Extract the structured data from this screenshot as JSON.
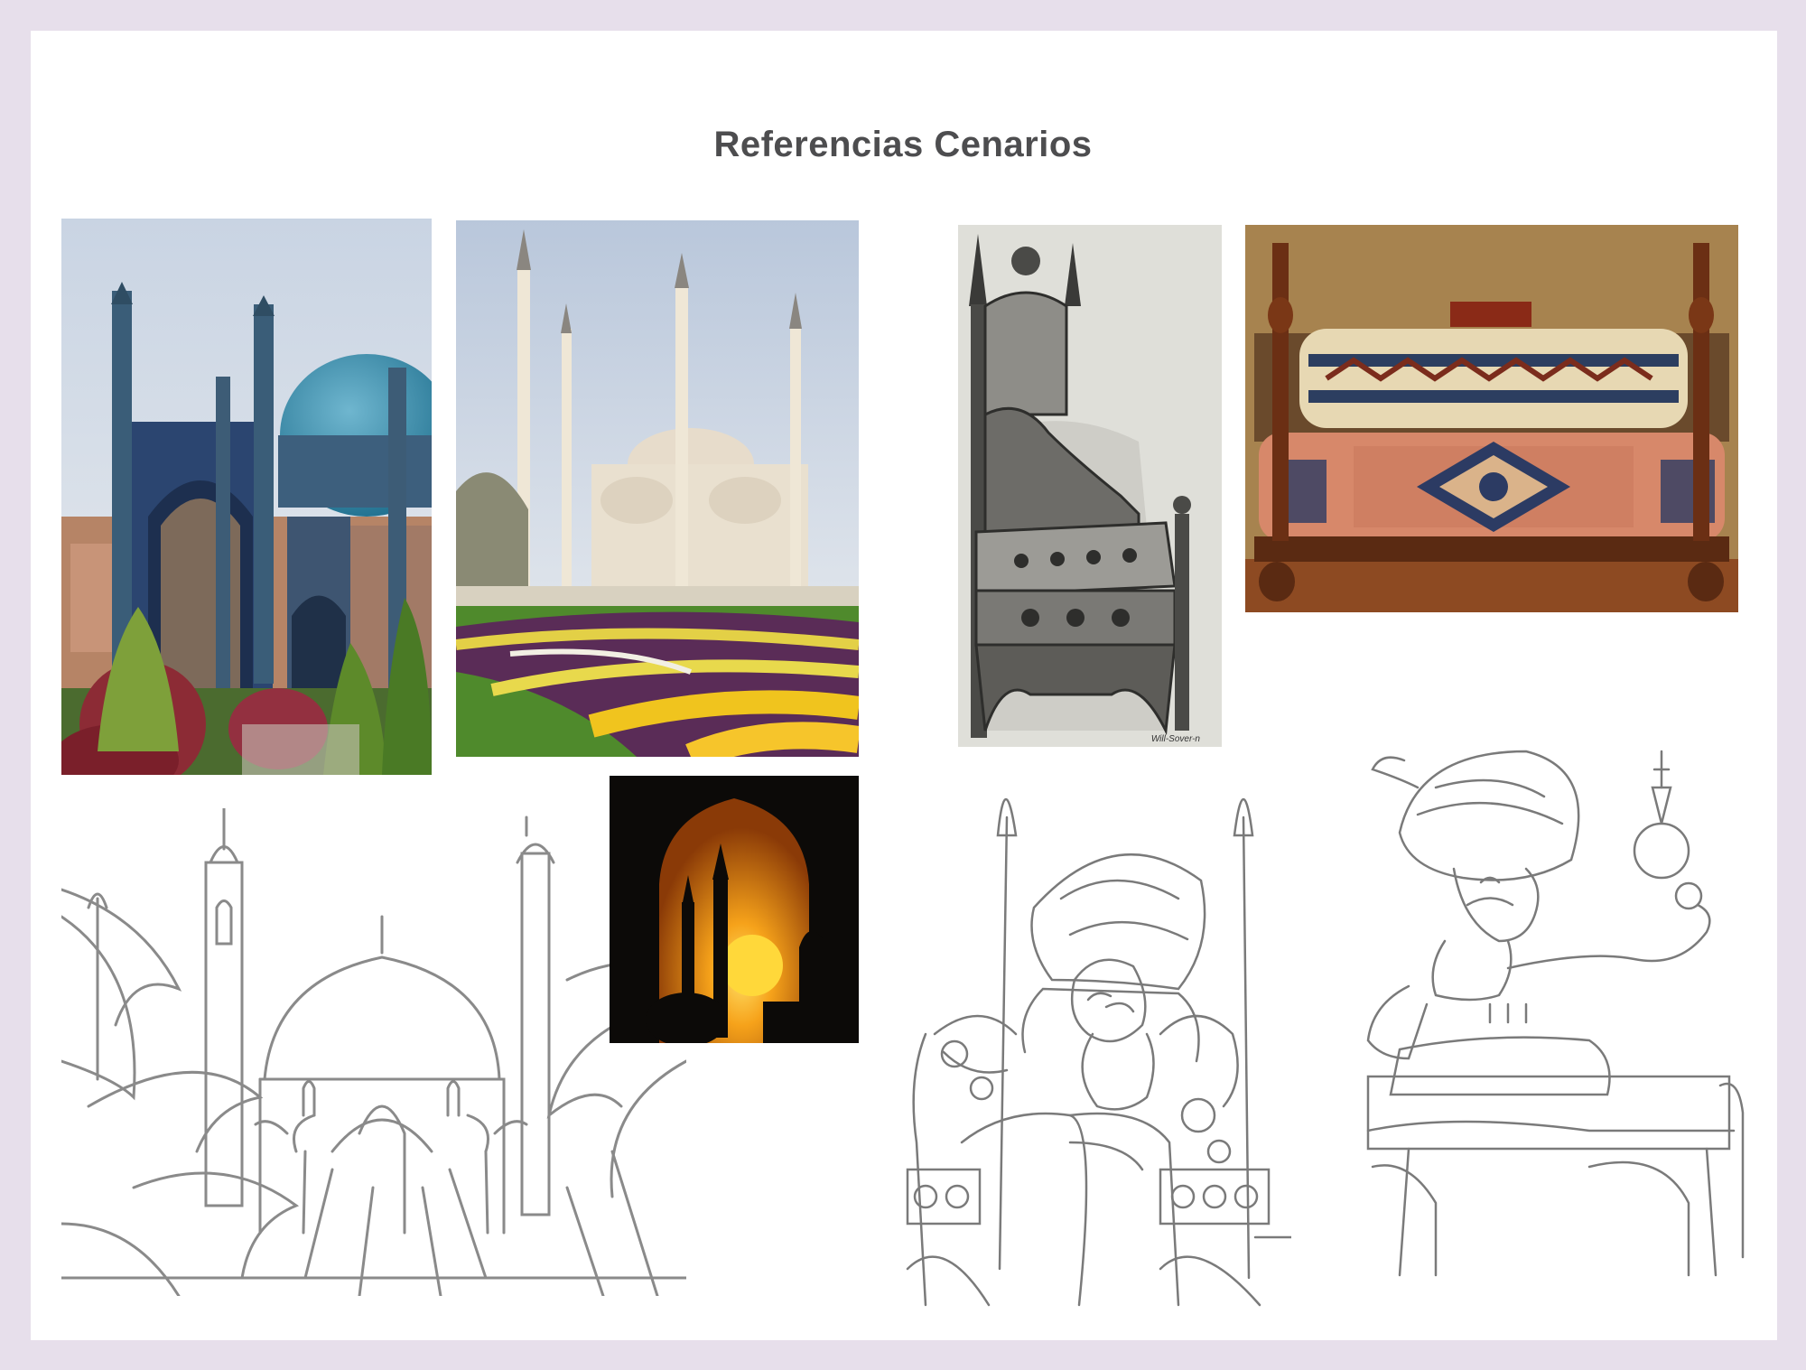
{
  "page": {
    "title": "Referencias Cenarios"
  },
  "images": [
    {
      "name": "photo-mosque-blue-dome",
      "kind": "photo"
    },
    {
      "name": "photo-mosque-tulip-garden",
      "kind": "photo"
    },
    {
      "name": "drawing-carved-throne",
      "kind": "ink-illustration",
      "signature": "Will-Sover-n"
    },
    {
      "name": "photo-carpet-sofa",
      "kind": "photo"
    },
    {
      "name": "sketch-palace-line-art",
      "kind": "line-art"
    },
    {
      "name": "photo-sunset-arch-minarets",
      "kind": "photo"
    },
    {
      "name": "sketch-sultan-on-throne",
      "kind": "pencil-sketch"
    },
    {
      "name": "sketch-sultan-holding-scepter",
      "kind": "pencil-sketch"
    }
  ],
  "colors": {
    "background": "#e7dfeb",
    "sheet": "#ffffff",
    "title": "#4d4d4f"
  }
}
